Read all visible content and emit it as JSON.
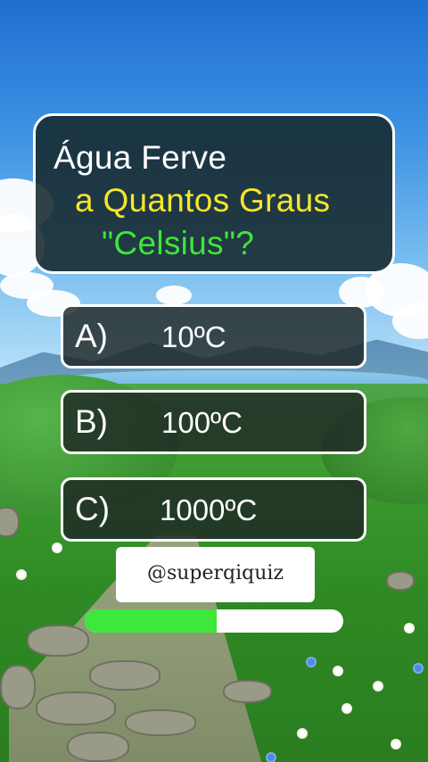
{
  "question": {
    "line1": "Água Ferve",
    "line2": "a Quantos Graus",
    "line3": "\"Celsius\"?",
    "colors": {
      "line1": "#ffffff",
      "line2": "#f5e62a",
      "line3": "#3fe637"
    }
  },
  "options": [
    {
      "letter": "A)",
      "value": "10ºC"
    },
    {
      "letter": "B)",
      "value": "100ºC"
    },
    {
      "letter": "C)",
      "value": "1000ºC"
    }
  ],
  "handle": "@superqiquiz",
  "timer": {
    "progress_fraction": 0.51,
    "fill_color": "#3de83a"
  }
}
